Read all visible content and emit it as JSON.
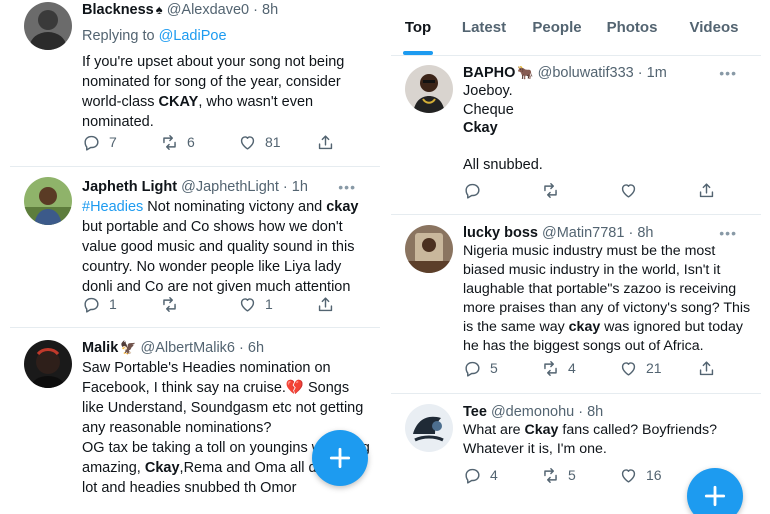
{
  "left_feed": {
    "tweets": [
      {
        "name": "Blackness",
        "name_emoji": "♠",
        "handle": "@Alexdave0",
        "time": "8h",
        "replying_label": "Replying to ",
        "replying_to": "@LadiPoe",
        "text_1": "If you're upset about your song not being nominated for song of the year, consider world-class ",
        "text_bold": "CKAY",
        "text_2": ", who wasn't even nominated.",
        "replies": "7",
        "retweets": "6",
        "likes": "81"
      },
      {
        "name": "Japheth Light",
        "handle": "@JaphethLight",
        "time": "1h",
        "hashtag": "#Headies",
        "text_1": " Not nominating victony and ",
        "text_bold": "ckay",
        "text_2": " but  portable and Co shows how we don't value good music and quality sound in this country. No wonder people like Liya lady donli and Co are not given much attention",
        "replies": "1",
        "retweets": "",
        "likes": "1"
      },
      {
        "name": "Malik",
        "name_emoji": "🦅",
        "handle": "@AlbertMalik6",
        "time": "6h",
        "text_1": "Saw Portable's Headies nomination on Facebook, I think say na cruise.",
        "broken_heart": "💔",
        "text_2": " Songs like Understand, Soundgasm etc not getting any reasonable nominations?",
        "text_3": "OG tax be taking a toll on youngins wh doing amazing, ",
        "text_bold": "Ckay",
        "text_4": ",Rema and Oma all doing a lot and headies snubbed th Omor"
      }
    ]
  },
  "right_feed": {
    "tabs": [
      "Top",
      "Latest",
      "People",
      "Photos",
      "Videos"
    ],
    "active_tab": "Top",
    "tweets": [
      {
        "name": "BAPHO",
        "name_emoji": "🐂",
        "handle": "@boluwatif333",
        "time": "1m",
        "line_1": "Joeboy.",
        "line_2": "Cheque",
        "line_3": "Ckay",
        "line_4": "All snubbed.",
        "replies": "",
        "retweets": "",
        "likes": ""
      },
      {
        "name": "lucky boss",
        "handle": "@Matin7781",
        "time": "8h",
        "text_1": "Nigeria music industry must be the most biased music industry in the world,  Isn't it laughable that portable\"s zazoo is receiving more praises than any of victony's song? This is the same way ",
        "text_bold": "ckay",
        "text_2": " was ignored but today he has the biggest songs out of Africa.",
        "replies": "5",
        "retweets": "4",
        "likes": "21"
      },
      {
        "name": "Tee",
        "handle": "@demonohu",
        "time": "8h",
        "text_1": "What are ",
        "text_bold": "Ckay",
        "text_2": " fans called? Boyfriends? Whatever it is, I'm one.",
        "replies": "4",
        "retweets": "5",
        "likes": "16"
      }
    ]
  },
  "common": {
    "dot": "·",
    "more": "•••",
    "accent_color": "#1d9bf0",
    "icons": [
      "reply-icon",
      "retweet-icon",
      "like-icon",
      "share-icon",
      "compose-icon",
      "more-icon"
    ]
  }
}
